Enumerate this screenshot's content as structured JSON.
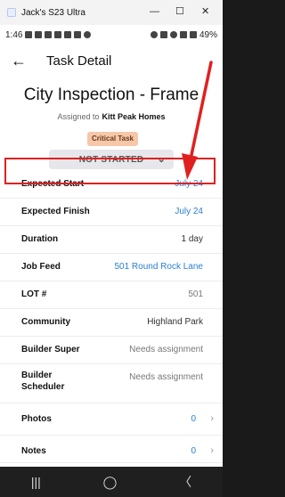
{
  "window": {
    "title": "Jack's S23 Ultra",
    "min_label": "—",
    "max_label": "☐",
    "close_label": "✕"
  },
  "statusbar": {
    "time": "1:46",
    "battery": "49%"
  },
  "header": {
    "back_glyph": "←",
    "title": "Task Detail"
  },
  "task": {
    "title": "City Inspection - Frame",
    "assigned_prefix": "Assigned to",
    "assigned_company": "Kitt Peak Homes",
    "badge": "Critical Task",
    "status": "NOT STARTED",
    "status_chevron": "⌄"
  },
  "rows": [
    {
      "label": "Expected Start",
      "value": "July 24"
    },
    {
      "label": "Expected Finish",
      "value": "July 24"
    },
    {
      "label": "Duration",
      "value": "1 day"
    },
    {
      "label": "Job Feed",
      "value": "501 Round Rock Lane"
    },
    {
      "label": "LOT #",
      "value": "501"
    },
    {
      "label": "Community",
      "value": "Highland Park"
    },
    {
      "label": "Builder Super",
      "value": "Needs assignment"
    },
    {
      "label": "Builder Scheduler",
      "value": "Needs assignment"
    },
    {
      "label": "Photos",
      "value": "0"
    },
    {
      "label": "Notes",
      "value": "0"
    }
  ],
  "navbar": {
    "recent": "|||",
    "home": "◯",
    "back": "〈"
  },
  "colors": {
    "accent_blue": "#2a7fd4",
    "highlight_red": "#e02020",
    "badge_bg": "#f6c7a8"
  }
}
